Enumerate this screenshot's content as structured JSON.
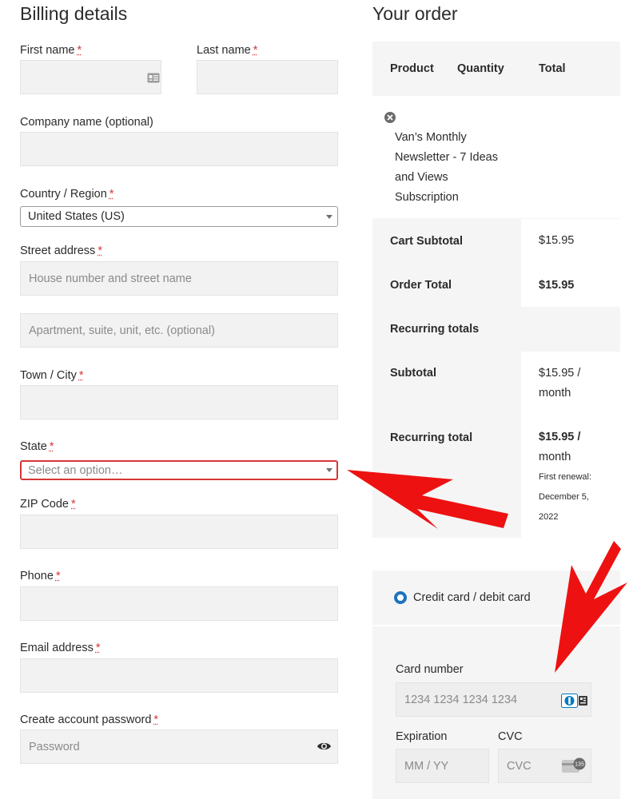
{
  "billing": {
    "title": "Billing details",
    "first_name": {
      "label": "First name",
      "required": "*"
    },
    "last_name": {
      "label": "Last name",
      "required": "*"
    },
    "company": {
      "label": "Company name (optional)"
    },
    "country": {
      "label": "Country / Region",
      "required": "*",
      "value": "United States (US)"
    },
    "street": {
      "label": "Street address",
      "required": "*",
      "placeholder1": "House number and street name",
      "placeholder2": "Apartment, suite, unit, etc. (optional)"
    },
    "city": {
      "label": "Town / City",
      "required": "*"
    },
    "state": {
      "label": "State",
      "required": "*",
      "value": "Select an option…"
    },
    "zip": {
      "label": "ZIP Code",
      "required": "*"
    },
    "phone": {
      "label": "Phone",
      "required": "*"
    },
    "email": {
      "label": "Email address",
      "required": "*"
    },
    "password": {
      "label": "Create account password",
      "required": "*",
      "placeholder": "Password"
    }
  },
  "order": {
    "title": "Your order",
    "headers": {
      "product": "Product",
      "quantity": "Quantity",
      "total": "Total"
    },
    "product_lines": [
      "Van’s Monthly",
      "Newsletter - 7 Ideas",
      "and Views",
      "Subscription"
    ],
    "cart_subtotal_label": "Cart Subtotal",
    "cart_subtotal_value": "$15.95",
    "order_total_label": "Order Total",
    "order_total_value": "$15.95",
    "recurring_totals_label": "Recurring totals",
    "subtotal_label": "Subtotal",
    "subtotal_value_lines": [
      "$15.95 /",
      "month"
    ],
    "recurring_total_label": "Recurring total",
    "recurring_total_value_lines": [
      "$15.95 /",
      "month"
    ],
    "first_renewal_lines": [
      "First renewal:",
      "December 5,",
      "2022"
    ]
  },
  "payment": {
    "method_label": "Credit card / debit card",
    "card_number_label": "Card number",
    "card_number_placeholder": "1234 1234 1234 1234",
    "expiration_label": "Expiration",
    "expiration_placeholder": "MM / YY",
    "cvc_label": "CVC",
    "cvc_placeholder": "CVC",
    "cvc_badge": "135"
  },
  "colors": {
    "required": "#d63638",
    "error": "#d63638",
    "radio": "#1e73be",
    "arrow": "#ee1111"
  },
  "icons": {
    "autofill": "contact-card-icon",
    "remove": "remove-item-icon",
    "eye": "eye-icon",
    "card": "card-brand-icon",
    "cvc": "cvc-card-icon"
  }
}
